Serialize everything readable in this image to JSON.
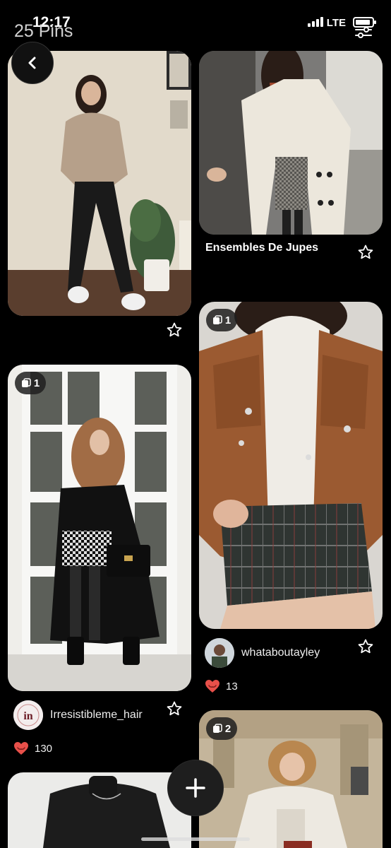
{
  "status_bar": {
    "time": "12:17",
    "network": "LTE"
  },
  "header": {
    "title": "25 Pins"
  },
  "pins": [
    {
      "id": "pin-1",
      "caption": "",
      "badge": ""
    },
    {
      "id": "pin-2",
      "caption": "Ensembles De Jupes",
      "badge": ""
    },
    {
      "id": "pin-3",
      "badge": "1",
      "author": "whataboutayley",
      "likes": "13"
    },
    {
      "id": "pin-4",
      "badge": "1",
      "author": "Irresistibleme_hair",
      "likes": "130"
    },
    {
      "id": "pin-5",
      "badge": "2"
    },
    {
      "id": "pin-6",
      "badge": ""
    }
  ],
  "icons": {
    "back": "chevron-left-icon",
    "star": "star-outline-icon",
    "heart": "heart-icon",
    "add": "plus-icon",
    "board": "board-icon",
    "filter": "sliders-icon"
  },
  "colors": {
    "background": "#000000",
    "heart": "#e8504a",
    "text": "#ffffff"
  }
}
